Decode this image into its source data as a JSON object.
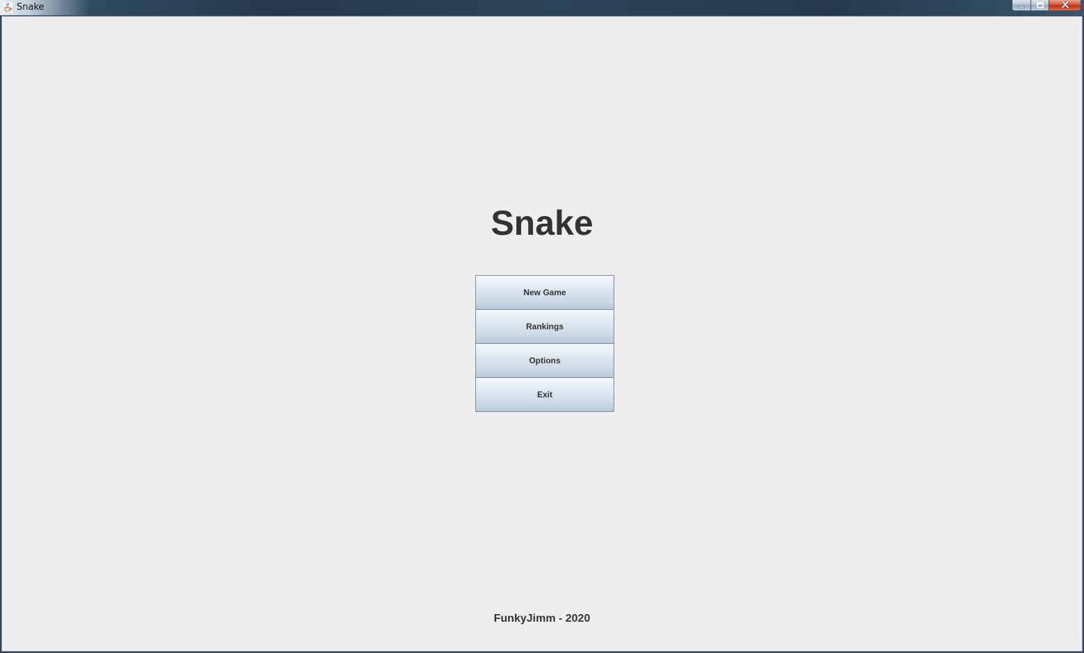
{
  "window": {
    "title": "Snake"
  },
  "main": {
    "title": "Snake",
    "menu": [
      {
        "label": "New Game"
      },
      {
        "label": "Rankings"
      },
      {
        "label": "Options"
      },
      {
        "label": "Exit"
      }
    ],
    "footer": "FunkyJimm - 2020"
  },
  "icons": {
    "app": "java-cup-icon",
    "minimize": "minimize-icon",
    "maximize": "maximize-icon",
    "close": "close-icon"
  },
  "colors": {
    "background": "#eeeeee",
    "text": "#333333",
    "button_border": "#7a8a99",
    "close_button": "#c23214"
  }
}
